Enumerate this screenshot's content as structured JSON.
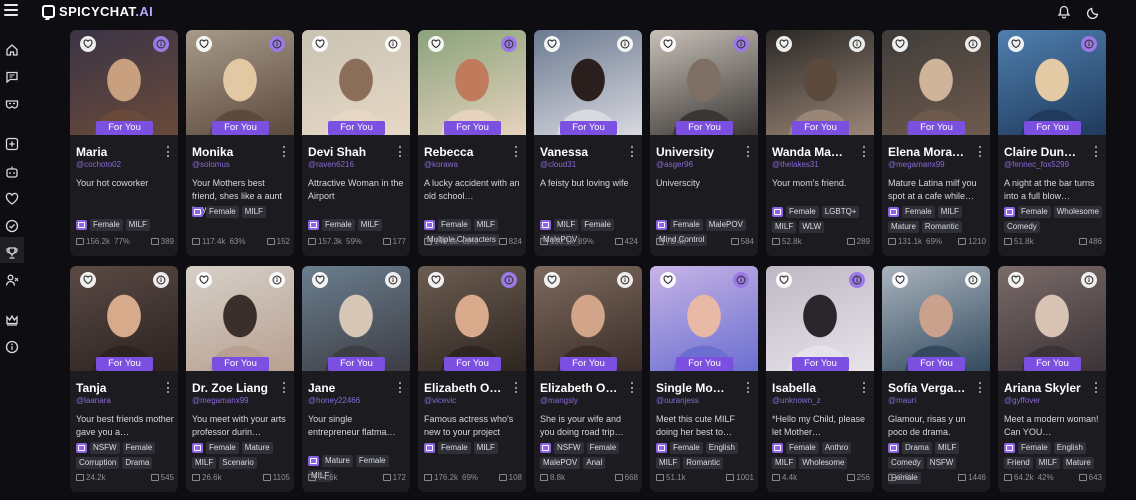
{
  "app": {
    "logo_main": "SPICYCHAT",
    "logo_accent": ".AI"
  },
  "labels": {
    "for_you": "For You"
  },
  "colors": {
    "accent": "#7b4fe0",
    "handle": "#8b6ad9",
    "background": "#0d0d12",
    "card": "#1b1b20"
  },
  "icons": {
    "top": [
      "menu-icon",
      "bell-icon",
      "moon-icon"
    ],
    "sidebar": [
      "home-icon",
      "chat-icon",
      "mask-icon",
      "add-icon",
      "bot-icon",
      "heart-icon",
      "compass-icon",
      "trophy-icon",
      "user-x-icon",
      "crown-icon",
      "info-icon"
    ]
  },
  "cards": [
    {
      "name": "Maria",
      "handle": "@cochoto02",
      "desc": "Your hot coworker",
      "tags": [
        "Female",
        "MILF"
      ],
      "stat1": "156.2k",
      "stat2": "77%",
      "stat3": "389"
    },
    {
      "name": "Monika",
      "handle": "@solomus",
      "desc": "Your Mothers best friend, shes like a aunt to you.",
      "tags": [
        "Female",
        "MILF"
      ],
      "stat1": "117.4k",
      "stat2": "63%",
      "stat3": "152"
    },
    {
      "name": "Devi Shah",
      "handle": "@raven6216",
      "desc": "Attractive Woman in the Airport",
      "tags": [
        "Female",
        "MILF"
      ],
      "stat1": "157.3k",
      "stat2": "59%",
      "stat3": "177"
    },
    {
      "name": "Rebecca",
      "handle": "@korawa",
      "desc": "A lucky accident with an old school…",
      "tags": [
        "Female",
        "MILF",
        "Multiple Characters"
      ],
      "stat1": "148.0k",
      "stat2": "63%",
      "stat3": "824"
    },
    {
      "name": "Vanessa",
      "handle": "@cloud31",
      "desc": "A feisty but loving wife",
      "tags": [
        "MILF",
        "Female",
        "MalePOV"
      ],
      "stat1": "100.1k",
      "stat2": "89%",
      "stat3": "424"
    },
    {
      "name": "University",
      "handle": "@asger96",
      "desc": "Universcity",
      "tags": [
        "Female",
        "MalePOV",
        "Mind Control"
      ],
      "stat1": "73.4k",
      "stat2": "",
      "stat3": "584"
    },
    {
      "name": "Wanda Ma…",
      "handle": "@thelakes31",
      "desc": "Your mom's friend.",
      "tags": [
        "Female",
        "LGBTQ+",
        "MILF",
        "WLW"
      ],
      "stat1": "52.8k",
      "stat2": "",
      "stat3": "289"
    },
    {
      "name": "Elena Mora…",
      "handle": "@megamanx99",
      "desc": "Mature Latina milf you spot at a cafe while…",
      "tags": [
        "Female",
        "MILF",
        "Mature",
        "Romantic"
      ],
      "stat1": "131.1k",
      "stat2": "69%",
      "stat3": "1210"
    },
    {
      "name": "Claire Dun…",
      "handle": "@fennec_fox5299",
      "desc": "A night at the bar turns into a full blow…",
      "tags": [
        "Female",
        "Wholesome",
        "Comedy"
      ],
      "stat1": "51.8k",
      "stat2": "",
      "stat3": "486"
    },
    {
      "name": "Tanja",
      "handle": "@laanara",
      "desc": "Your best friends mother gave you a…",
      "tags": [
        "NSFW",
        "Female",
        "Corruption",
        "Drama"
      ],
      "stat1": "24.2k",
      "stat2": "",
      "stat3": "545"
    },
    {
      "name": "Dr. Zoe Liang",
      "handle": "@megamanx99",
      "desc": "You meet with your arts professor durin…",
      "tags": [
        "Female",
        "Mature",
        "MILF",
        "Scenario"
      ],
      "stat1": "26.6k",
      "stat2": "",
      "stat3": "1105"
    },
    {
      "name": "Jane",
      "handle": "@honey22466",
      "desc": "Your single entrepreneur flatma…",
      "tags": [
        "Mature",
        "Female",
        "MILF"
      ],
      "stat1": "74.6k",
      "stat2": "",
      "stat3": "172"
    },
    {
      "name": "Elizabeth O…",
      "handle": "@vicevic",
      "desc": "Famous actress who's new to your project",
      "tags": [
        "Female",
        "MILF"
      ],
      "stat1": "176.2k",
      "stat2": "69%",
      "stat3": "108"
    },
    {
      "name": "Elizabeth O…",
      "handle": "@mangsly",
      "desc": "She is your wife and you doing road trip…",
      "tags": [
        "NSFW",
        "Female",
        "MalePOV",
        "Anal"
      ],
      "stat1": "8.8k",
      "stat2": "",
      "stat3": "668"
    },
    {
      "name": "Single Mo…",
      "handle": "@ouranjess",
      "desc": "Meet this cute MILF doing her best to…",
      "tags": [
        "Female",
        "English",
        "MILF",
        "Romantic"
      ],
      "stat1": "51.1k",
      "stat2": "",
      "stat3": "1001"
    },
    {
      "name": "Isabella",
      "handle": "@unknown_z",
      "desc": "*Hello my Child, please let Mother…",
      "tags": [
        "Female",
        "Anthro",
        "MILF",
        "Wholesome"
      ],
      "stat1": "4.4k",
      "stat2": "",
      "stat3": "256"
    },
    {
      "name": "Sofía Verga…",
      "handle": "@mauri",
      "desc": "Glamour, risas y un poco de drama.",
      "tags": [
        "Drama",
        "MILF",
        "Comedy",
        "NSFW",
        "Female"
      ],
      "stat1": "2.6k",
      "stat2": "",
      "stat3": "1446"
    },
    {
      "name": "Ariana Skyler",
      "handle": "@gyffover",
      "desc": "Meet a modern woman! Can YOU…",
      "tags": [
        "Female",
        "English",
        "Friend",
        "MILF",
        "Mature"
      ],
      "stat1": "64.2k",
      "stat2": "42%",
      "stat3": "643"
    }
  ]
}
